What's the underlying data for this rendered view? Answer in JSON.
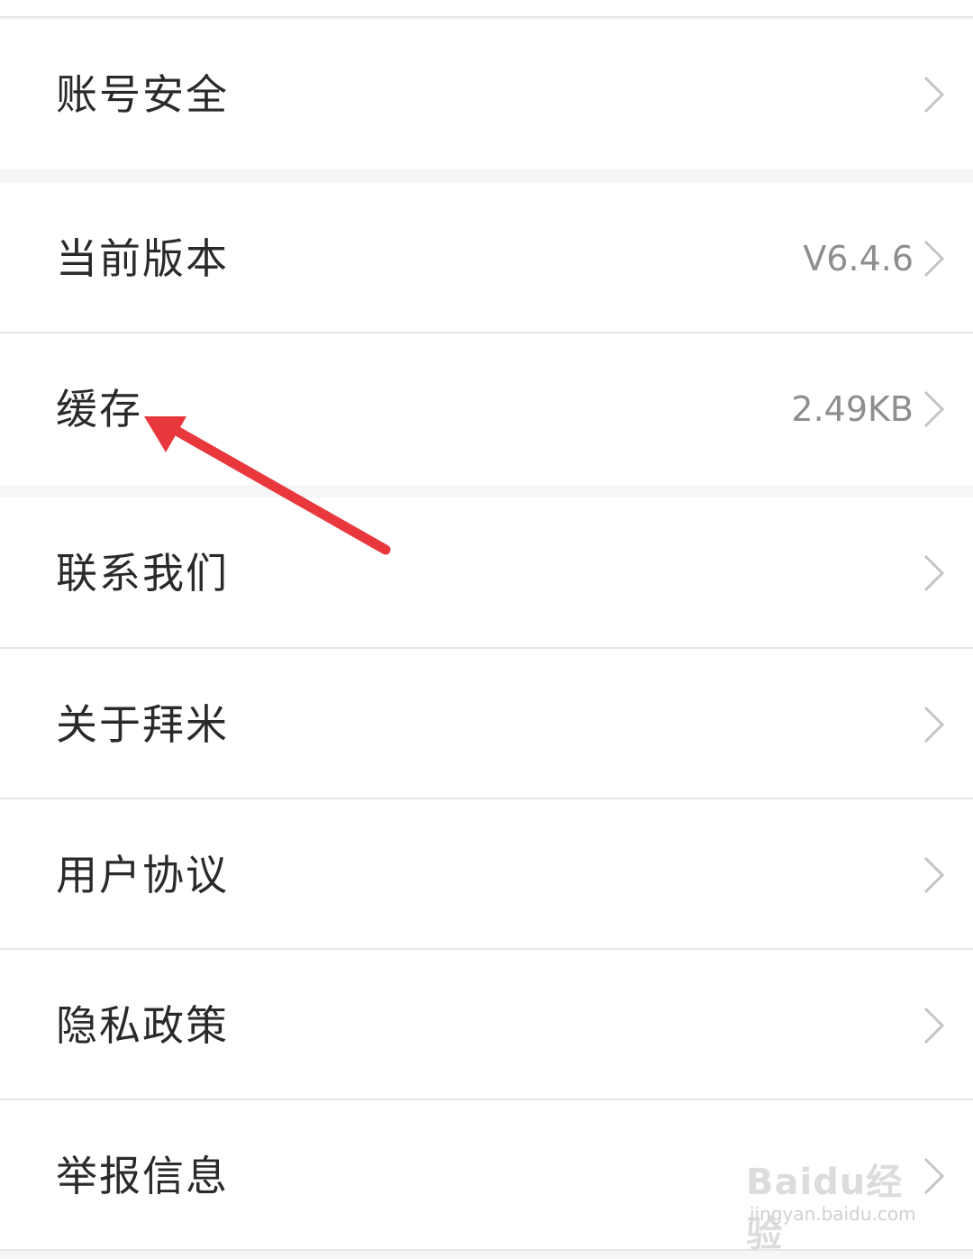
{
  "settings": {
    "items": [
      {
        "label": "账号安全",
        "value": ""
      },
      {
        "label": "当前版本",
        "value": "V6.4.6"
      },
      {
        "label": "缓存",
        "value": "2.49KB"
      },
      {
        "label": "联系我们",
        "value": ""
      },
      {
        "label": "关于拜米",
        "value": ""
      },
      {
        "label": "用户协议",
        "value": ""
      },
      {
        "label": "隐私政策",
        "value": ""
      },
      {
        "label": "举报信息",
        "value": ""
      }
    ]
  },
  "annotation": {
    "arrow_color": "#e8383d",
    "points_to": "缓存"
  },
  "watermark": {
    "logo": "Baidu经验",
    "url": "jingyan.baidu.com"
  },
  "colors": {
    "background": "#f6f6f6",
    "row": "#ffffff",
    "label": "#2a2a2a",
    "value": "#8e8e8e",
    "chevron": "#c4c4c4"
  }
}
